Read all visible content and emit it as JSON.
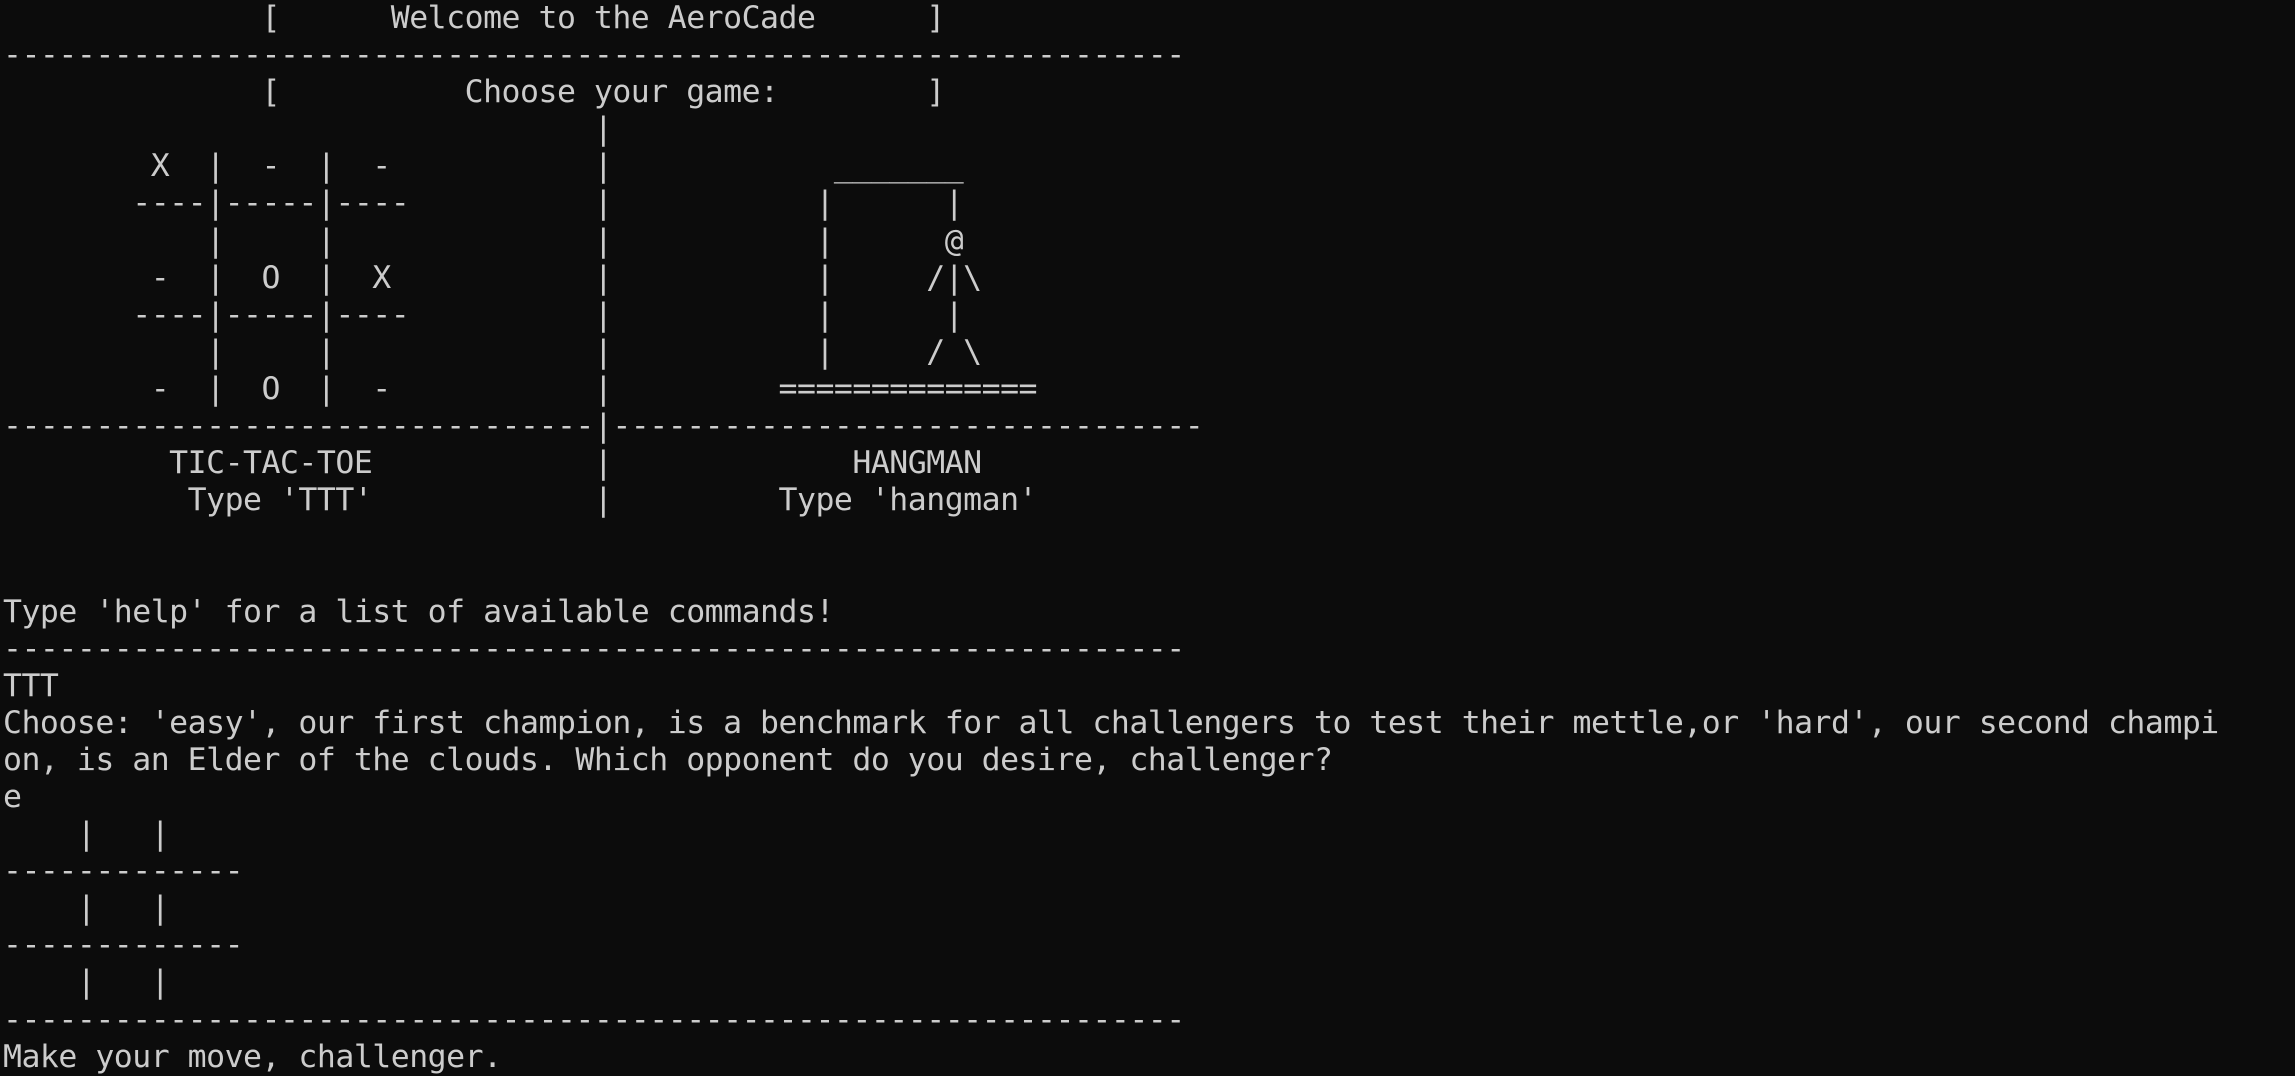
{
  "terminal": {
    "lines": [
      "              [      Welcome to the AeroCade      ]",
      "----------------------------------------------------------------",
      "              [          Choose your game:        ]",
      "                                |",
      "        X  |  -  |  -           |            _______",
      "       ----|-----|----          |           |      |",
      "           |     |              |           |      @",
      "        -  |  O  |  X           |           |     /|\\",
      "       ----|-----|----          |           |      |",
      "           |     |              |           |     / \\",
      "        -  |  O  |  -           |         ==============",
      "--------------------------------|--------------------------------",
      "         TIC-TAC-TOE            |             HANGMAN",
      "          Type 'TTT'            |         Type 'hangman'",
      "",
      "",
      "Type 'help' for a list of available commands!",
      "----------------------------------------------------------------",
      "TTT",
      "Choose: 'easy', our first champion, is a benchmark for all challengers to test their mettle,or 'hard', our second champi",
      "on, is an Elder of the clouds. Which opponent do you desire, challenger?",
      "e",
      "    |   |",
      "-------------",
      "    |   |",
      "-------------",
      "    |   |",
      "----------------------------------------------------------------",
      "Make your move, challenger."
    ]
  }
}
